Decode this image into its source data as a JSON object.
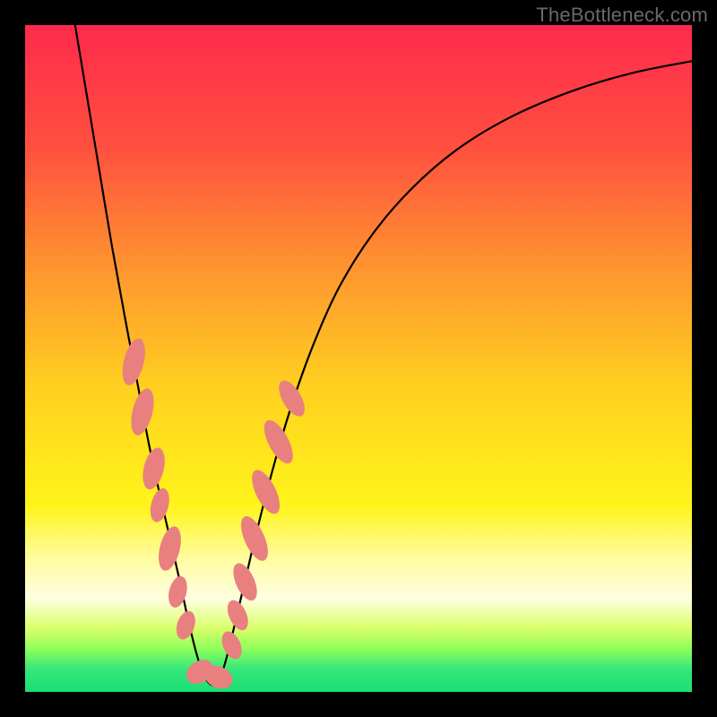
{
  "watermark": "TheBottleneck.com",
  "chart_data": {
    "type": "line",
    "title": "",
    "xlabel": "",
    "ylabel": "",
    "xlim": [
      0,
      100
    ],
    "ylim": [
      0,
      100
    ],
    "grid": false,
    "legend": false,
    "gradient_stops": [
      {
        "offset": 0.0,
        "color": "#ff2a4d"
      },
      {
        "offset": 0.18,
        "color": "#ff4f3f"
      },
      {
        "offset": 0.38,
        "color": "#ff9a2e"
      },
      {
        "offset": 0.55,
        "color": "#ffd21f"
      },
      {
        "offset": 0.72,
        "color": "#fff41a"
      },
      {
        "offset": 0.8,
        "color": "#fffca0"
      },
      {
        "offset": 0.86,
        "color": "#ffffe0"
      },
      {
        "offset": 0.905,
        "color": "#d9ff6a"
      },
      {
        "offset": 0.935,
        "color": "#8fff5a"
      },
      {
        "offset": 0.965,
        "color": "#38e87a"
      },
      {
        "offset": 1.0,
        "color": "#18df74"
      }
    ],
    "series": [
      {
        "name": "bottleneck-curve",
        "color": "#000000",
        "width": 2.2,
        "x": [
          7.5,
          9,
          11,
          13,
          15,
          17,
          18.5,
          20,
          21.5,
          23,
          24.3,
          25.5,
          26.5,
          27.5,
          28.5,
          29.5,
          30.5,
          32,
          34,
          36.5,
          39.5,
          43,
          47,
          52,
          58,
          65,
          73,
          82,
          91,
          100
        ],
        "y": [
          100,
          91,
          79,
          67,
          56,
          45.5,
          37.5,
          30.5,
          24,
          17.5,
          11.5,
          6.5,
          3.2,
          1.4,
          1.1,
          2.8,
          6.2,
          12.5,
          21,
          31,
          41.5,
          51.5,
          60.5,
          68.5,
          75.5,
          81.5,
          86.3,
          90.1,
          92.8,
          94.6
        ]
      }
    ],
    "markers": {
      "color": "#e98080",
      "points": [
        {
          "cx": 16.3,
          "cy": 49.5,
          "rx": 1.5,
          "ry": 3.6,
          "rot": 14
        },
        {
          "cx": 17.6,
          "cy": 42.0,
          "rx": 1.5,
          "ry": 3.6,
          "rot": 14
        },
        {
          "cx": 19.3,
          "cy": 33.5,
          "rx": 1.5,
          "ry": 3.2,
          "rot": 14
        },
        {
          "cx": 20.2,
          "cy": 28.0,
          "rx": 1.3,
          "ry": 2.6,
          "rot": 14
        },
        {
          "cx": 21.7,
          "cy": 21.5,
          "rx": 1.5,
          "ry": 3.4,
          "rot": 14
        },
        {
          "cx": 22.9,
          "cy": 15.0,
          "rx": 1.3,
          "ry": 2.4,
          "rot": 14
        },
        {
          "cx": 24.1,
          "cy": 10.0,
          "rx": 1.3,
          "ry": 2.2,
          "rot": 18
        },
        {
          "cx": 26.2,
          "cy": 3.0,
          "rx": 1.6,
          "ry": 2.2,
          "rot": 55
        },
        {
          "cx": 29.0,
          "cy": 2.2,
          "rx": 1.6,
          "ry": 2.2,
          "rot": 115
        },
        {
          "cx": 31.0,
          "cy": 7.0,
          "rx": 1.3,
          "ry": 2.2,
          "rot": -24
        },
        {
          "cx": 31.9,
          "cy": 11.5,
          "rx": 1.3,
          "ry": 2.4,
          "rot": -24
        },
        {
          "cx": 33.0,
          "cy": 16.5,
          "rx": 1.4,
          "ry": 3.0,
          "rot": -24
        },
        {
          "cx": 34.4,
          "cy": 23.0,
          "rx": 1.5,
          "ry": 3.6,
          "rot": -24
        },
        {
          "cx": 36.1,
          "cy": 30.0,
          "rx": 1.5,
          "ry": 3.6,
          "rot": -26
        },
        {
          "cx": 38.0,
          "cy": 37.5,
          "rx": 1.5,
          "ry": 3.6,
          "rot": -28
        },
        {
          "cx": 40.0,
          "cy": 44.0,
          "rx": 1.4,
          "ry": 3.0,
          "rot": -30
        }
      ]
    }
  }
}
